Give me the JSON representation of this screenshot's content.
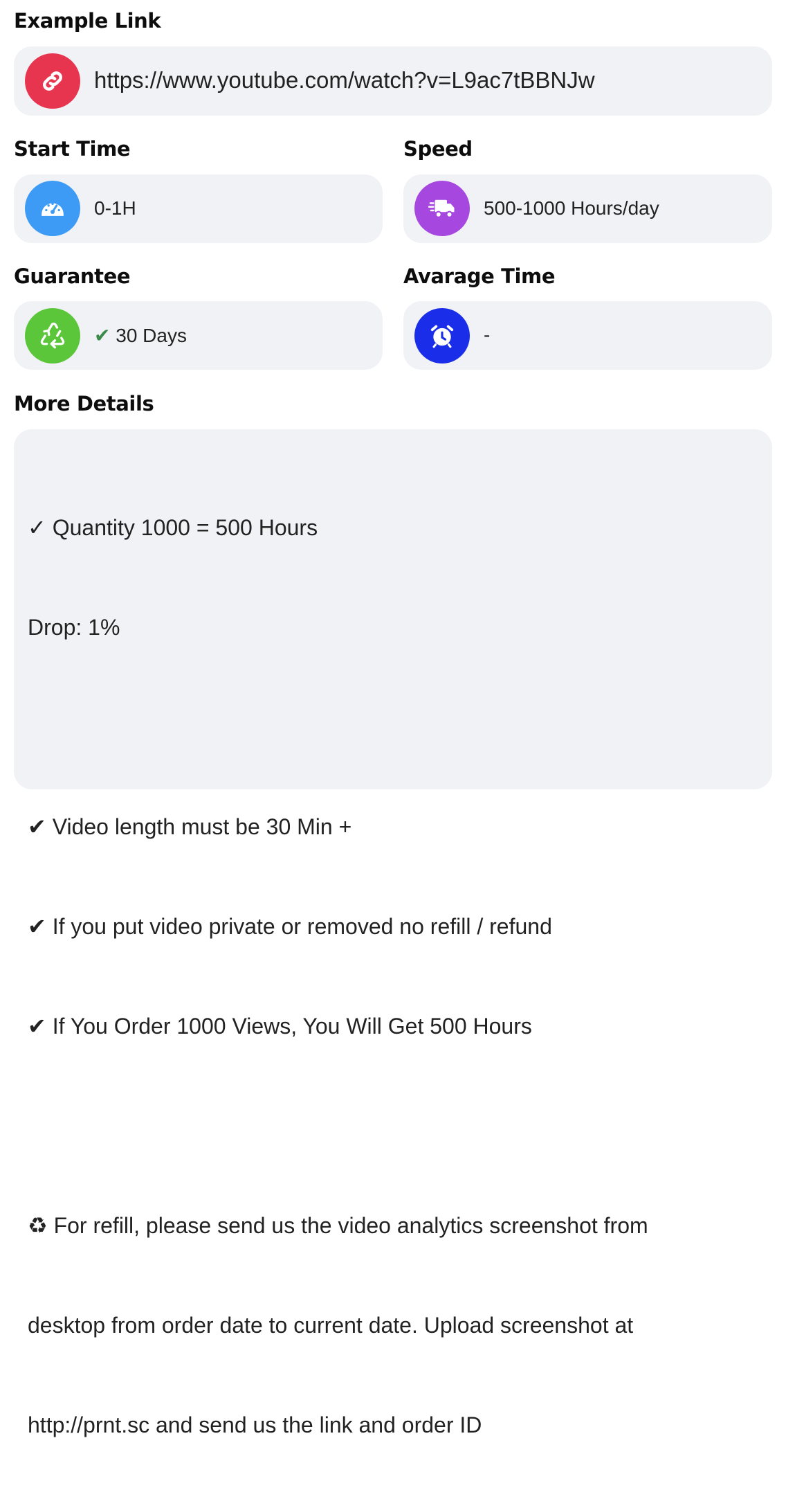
{
  "example_link": {
    "heading": "Example Link",
    "url": "https://www.youtube.com/watch?v=L9ac7tBBNJw",
    "icon": "link-icon",
    "icon_color": "#e8354f"
  },
  "start_time": {
    "heading": "Start Time",
    "value": "0-1H",
    "icon": "speedometer-icon",
    "icon_color": "#3d9bf5"
  },
  "speed": {
    "heading": "Speed",
    "value": "500-1000 Hours/day",
    "icon": "delivery-truck-icon",
    "icon_color": "#a647e0"
  },
  "guarantee": {
    "heading": "Guarantee",
    "check": "✔",
    "value": "30 Days",
    "icon": "recycle-icon",
    "icon_color": "#5cc63a"
  },
  "average_time": {
    "heading": "Avarage Time",
    "value": "-",
    "icon": "alarm-clock-icon",
    "icon_color": "#1a2de8"
  },
  "more_details": {
    "heading": "More Details",
    "lines": [
      "✓ Quantity 1000 = 500 Hours",
      "Drop: 1%",
      "",
      "✔ Video length must be 30 Min +",
      "✔ If you put video private or removed no refill / refund",
      "✔ If You Order 1000 Views, You Will Get 500 Hours",
      "",
      "♻ For refill, please send us the video analytics screenshot from",
      "desktop from order date to current date. Upload screenshot at",
      "http://prnt.sc and send us the link and order ID"
    ]
  }
}
